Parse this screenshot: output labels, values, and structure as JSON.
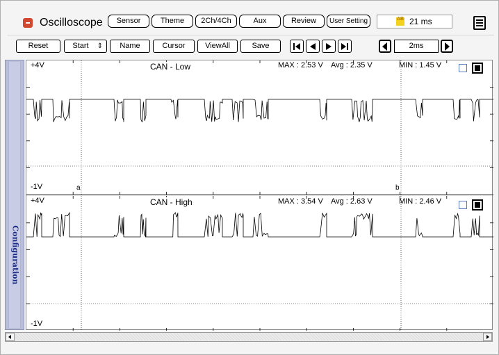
{
  "app": {
    "title": "Oscilloscope",
    "icon": "app-logo-icon"
  },
  "header": {
    "buttons": [
      "Sensor",
      "Theme",
      "2Ch/4Ch",
      "Aux",
      "Review",
      "User Setting"
    ],
    "timer": {
      "icon_label": "AB",
      "value": "21 ms"
    }
  },
  "toolbar": {
    "reset": "Reset",
    "start": "Start",
    "name": "Name",
    "cursor": "Cursor",
    "viewall": "ViewAll",
    "save": "Save",
    "timebase": "2ms"
  },
  "sidebar": {
    "label": "Configuration"
  },
  "channels": [
    {
      "name": "CAN - Low",
      "ymax_label": "+4V",
      "ymin_label": "-1V",
      "stats": {
        "max": "MAX : 2.53 V",
        "avg": "Avg : 2.35 V",
        "min": "MIN : 1.45 V"
      },
      "cursor_a": "a",
      "cursor_b": "b"
    },
    {
      "name": "CAN - High",
      "ymax_label": "+4V",
      "ymin_label": "-1V",
      "stats": {
        "max": "MAX : 3.54 V",
        "avg": "Avg : 2.63 V",
        "min": "MIN : 2.46 V"
      }
    }
  ],
  "colors": {
    "accent": "#d2472f",
    "sidebar": "#b9bed9",
    "sidebar_text": "#1b2c8a",
    "checkbox": "#5c7ac4"
  }
}
